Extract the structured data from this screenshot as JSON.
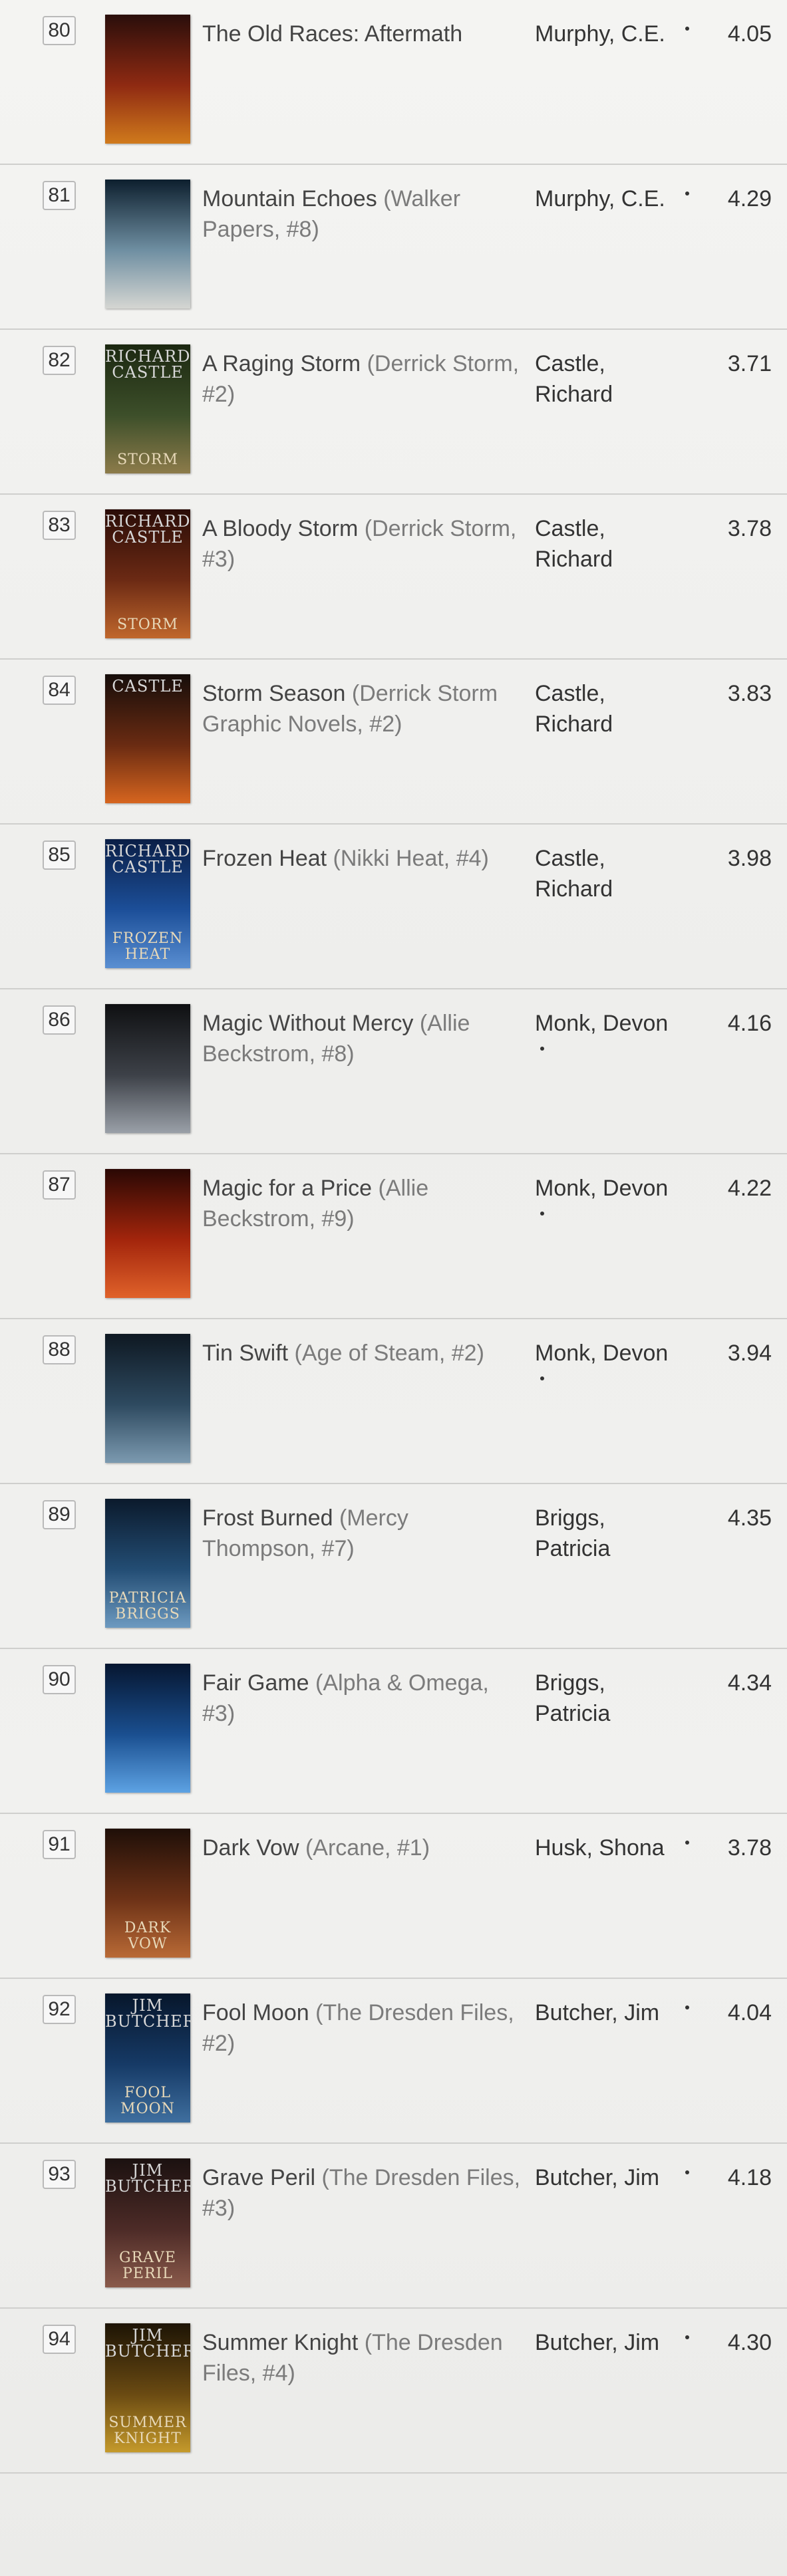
{
  "books": [
    {
      "rank": "80",
      "title": "The Old Races: Aftermath",
      "series": "",
      "author_lines": [
        "Murphy, C.E."
      ],
      "rating": "4.05",
      "asterisk": true,
      "cover": {
        "top": "",
        "bottom": "",
        "colors": [
          "#2a0e0b",
          "#8f2a12",
          "#d07a1c"
        ]
      }
    },
    {
      "rank": "81",
      "title": "Mountain Echoes",
      "series": "(Walker Papers, #8)",
      "author_lines": [
        "Murphy, C.E."
      ],
      "rating": "4.29",
      "asterisk": true,
      "cover": {
        "top": "",
        "bottom": "",
        "colors": [
          "#0d1f2e",
          "#6f8fa2",
          "#d5d6d2"
        ]
      }
    },
    {
      "rank": "82",
      "title": "A Raging Storm",
      "series": "(Derrick Storm, #2)",
      "author_lines": [
        "Castle,",
        "Richard"
      ],
      "rating": "3.71",
      "asterisk": false,
      "cover": {
        "top": "RICHARD CASTLE",
        "bottom": "STORM",
        "colors": [
          "#1b2710",
          "#3d4f2a",
          "#8c7b4a"
        ]
      }
    },
    {
      "rank": "83",
      "title": "A Bloody Storm",
      "series": "(Derrick Storm, #3)",
      "author_lines": [
        "Castle,",
        "Richard"
      ],
      "rating": "3.78",
      "asterisk": false,
      "cover": {
        "top": "RICHARD CASTLE",
        "bottom": "STORM",
        "colors": [
          "#2a0c07",
          "#6c2a14",
          "#c0672c"
        ]
      }
    },
    {
      "rank": "84",
      "title": "Storm Season",
      "series": "(Derrick Storm Graphic Novels, #2)",
      "author_lines": [
        "Castle,",
        "Richard"
      ],
      "rating": "3.83",
      "asterisk": false,
      "cover": {
        "top": "CASTLE",
        "bottom": "",
        "colors": [
          "#160d0a",
          "#6a2b12",
          "#d6651f"
        ]
      }
    },
    {
      "rank": "85",
      "title": "Frozen Heat",
      "series": "(Nikki Heat, #4)",
      "author_lines": [
        "Castle,",
        "Richard"
      ],
      "rating": "3.98",
      "asterisk": false,
      "cover": {
        "top": "RICHARD CASTLE",
        "bottom": "FROZEN HEAT",
        "colors": [
          "#0a1e46",
          "#1c4f99",
          "#5a8fd2"
        ]
      }
    },
    {
      "rank": "86",
      "title": "Magic Without Mercy",
      "series": "(Allie Beckstrom, #8)",
      "author_lines": [
        "Monk, Devon"
      ],
      "rating": "4.16",
      "asterisk": true,
      "cover": {
        "top": "",
        "bottom": "",
        "colors": [
          "#0f1012",
          "#3d4148",
          "#9aa0a8"
        ]
      }
    },
    {
      "rank": "87",
      "title": "Magic for a Price",
      "series": "(Allie Beckstrom, #9)",
      "author_lines": [
        "Monk, Devon"
      ],
      "rating": "4.22",
      "asterisk": true,
      "cover": {
        "top": "",
        "bottom": "",
        "colors": [
          "#2a0804",
          "#a3250c",
          "#e0622a"
        ]
      }
    },
    {
      "rank": "88",
      "title": "Tin Swift",
      "series": "(Age of Steam, #2)",
      "author_lines": [
        "Monk, Devon"
      ],
      "rating": "3.94",
      "asterisk": true,
      "cover": {
        "top": "",
        "bottom": "",
        "colors": [
          "#0e1822",
          "#2e4a60",
          "#7c9ab0"
        ]
      }
    },
    {
      "rank": "89",
      "title": "Frost Burned",
      "series": "(Mercy Thompson, #7)",
      "author_lines": [
        "Briggs,",
        "Patricia"
      ],
      "rating": "4.35",
      "asterisk": false,
      "cover": {
        "top": "",
        "bottom": "PATRICIA BRIGGS",
        "colors": [
          "#0b1a2c",
          "#234d74",
          "#6d9ac0"
        ]
      }
    },
    {
      "rank": "90",
      "title": "Fair Game",
      "series": "(Alpha & Omega, #3)",
      "author_lines": [
        "Briggs,",
        "Patricia"
      ],
      "rating": "4.34",
      "asterisk": false,
      "cover": {
        "top": "",
        "bottom": "",
        "colors": [
          "#061630",
          "#1a4f90",
          "#5da2e3"
        ]
      }
    },
    {
      "rank": "91",
      "title": "Dark Vow",
      "series": "(Arcane, #1)",
      "author_lines": [
        "Husk, Shona"
      ],
      "rating": "3.78",
      "asterisk": true,
      "cover": {
        "top": "",
        "bottom": "DARK VOW",
        "colors": [
          "#1f0f08",
          "#6d3217",
          "#b96a36"
        ]
      }
    },
    {
      "rank": "92",
      "title": "Fool Moon",
      "series": "(The Dresden Files, #2)",
      "author_lines": [
        "Butcher, Jim"
      ],
      "rating": "4.04",
      "asterisk": true,
      "cover": {
        "top": "JIM BUTCHER",
        "bottom": "FOOL MOON",
        "colors": [
          "#07162b",
          "#163a66",
          "#3f6f9f"
        ]
      }
    },
    {
      "rank": "93",
      "title": "Grave Peril",
      "series": "(The Dresden Files, #3)",
      "author_lines": [
        "Butcher, Jim"
      ],
      "rating": "4.18",
      "asterisk": true,
      "cover": {
        "top": "JIM BUTCHER",
        "bottom": "GRAVE PERIL",
        "colors": [
          "#1b1110",
          "#4d2b27",
          "#8a5a4b"
        ]
      }
    },
    {
      "rank": "94",
      "title": "Summer Knight",
      "series": "(The Dresden Files, #4)",
      "author_lines": [
        "Butcher, Jim"
      ],
      "rating": "4.30",
      "asterisk": true,
      "cover": {
        "top": "JIM BUTCHER",
        "bottom": "SUMMER KNIGHT",
        "colors": [
          "#1d1405",
          "#6a4a12",
          "#c59a2b"
        ]
      }
    }
  ]
}
